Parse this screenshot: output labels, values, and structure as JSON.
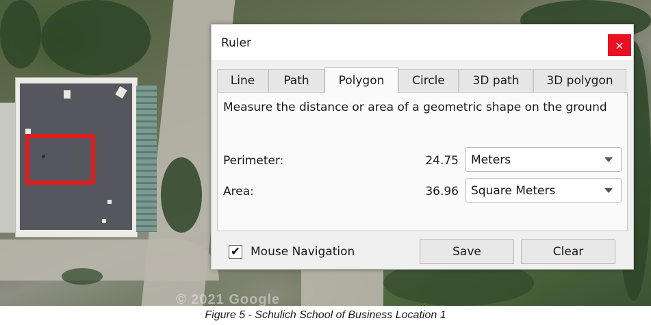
{
  "map": {
    "watermark": "© 2021 Google"
  },
  "dialog": {
    "title": "Ruler",
    "close_icon": "×",
    "tabs": [
      {
        "label": "Line"
      },
      {
        "label": "Path"
      },
      {
        "label": "Polygon",
        "active": true
      },
      {
        "label": "Circle"
      },
      {
        "label": "3D path"
      },
      {
        "label": "3D polygon"
      }
    ],
    "description": "Measure the distance or area of a geometric shape on the ground",
    "perimeter": {
      "label": "Perimeter:",
      "value": "24.75",
      "unit": "Meters"
    },
    "area": {
      "label": "Area:",
      "value": "36.96",
      "unit": "Square Meters"
    },
    "mouse_navigation": {
      "label": "Mouse Navigation",
      "checked": true,
      "check_glyph": "✔"
    },
    "save_label": "Save",
    "clear_label": "Clear"
  },
  "caption": "Figure 5 - Schulich School of Business Location 1",
  "colors": {
    "close_button": "#e81123",
    "outline": "#e31b1b"
  }
}
